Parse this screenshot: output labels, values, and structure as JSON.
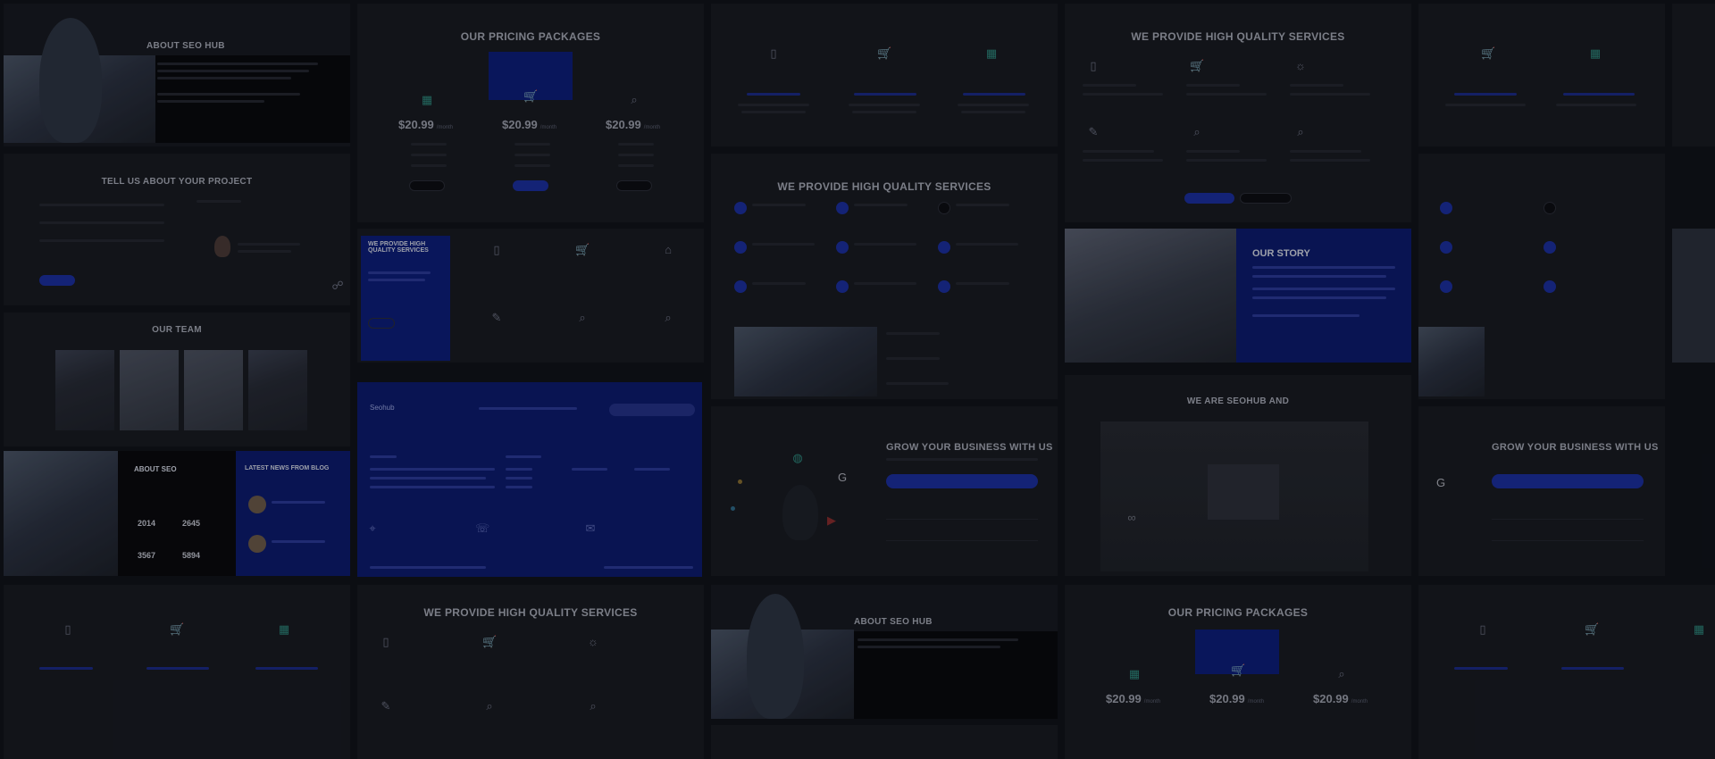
{
  "tiles": {
    "about_seo_hub": {
      "title": "ABOUT SEO HUB"
    },
    "pricing": {
      "title": "OUR PRICING PACKAGES",
      "plans": [
        {
          "price": "20.99",
          "featured": false
        },
        {
          "price": "20.99",
          "featured": true
        },
        {
          "price": "20.99",
          "featured": false
        }
      ]
    },
    "services_top": {
      "title": "WE PROVIDE HIGH QUALITY SERVICES"
    },
    "tell_us": {
      "title": "TELL US ABOUT YOUR PROJECT"
    },
    "services_mid": {
      "title": "WE PROVIDE HIGH QUALITY SERVICES"
    },
    "services_mid2": {
      "title": "WE PROVIDE HIGH QUALITY SERVICES"
    },
    "our_team": {
      "title": "OUR TEAM"
    },
    "our_story": {
      "title": "OUR STORY"
    },
    "we_are": {
      "title": "WE ARE SEOHUB AND"
    },
    "about_seo": {
      "title": "ABOUT SEO",
      "stats": [
        "2014",
        "2645",
        "3567",
        "5894"
      ]
    },
    "latest_news": {
      "title": "LATEST NEWS FROM BLOG"
    },
    "footer_logo": {
      "brand": "Seohub"
    },
    "grow": {
      "title": "GROW YOUR BUSINESS WITH US"
    },
    "grow2": {
      "title": "GROW YOUR BUSINESS WITH US"
    },
    "services_bottom": {
      "title": "WE PROVIDE HIGH QUALITY SERVICES"
    },
    "about_bottom": {
      "title": "ABOUT SEO HUB"
    },
    "pricing_bottom": {
      "title": "OUR PRICING PACKAGES",
      "plans": [
        {
          "price": "20.99"
        },
        {
          "price": "20.99"
        },
        {
          "price": "20.99"
        }
      ]
    },
    "services_bottom2": {
      "title": "WE PROVIDE HIGH QUALITY SERVICES"
    }
  }
}
